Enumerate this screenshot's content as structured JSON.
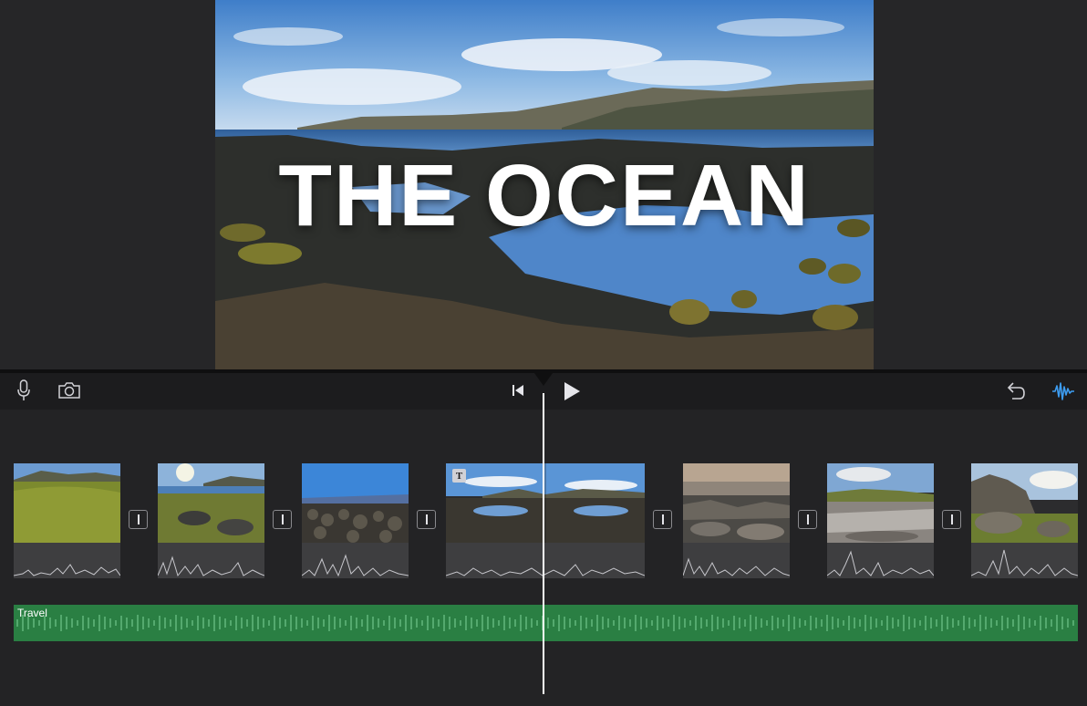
{
  "preview": {
    "title_text": "THE OCEAN"
  },
  "toolbar": {
    "voiceover_icon": "microphone-icon",
    "camera_icon": "camera-icon",
    "skip_back_icon": "skip-to-start-icon",
    "play_icon": "play-icon",
    "undo_icon": "undo-icon",
    "audio_icon": "audio-waveform-icon",
    "audio_icon_color": "#3d9cf0"
  },
  "timeline": {
    "clips": [
      {
        "name": "grassy-coast",
        "has_title": false
      },
      {
        "name": "rocky-shore-sun",
        "has_title": false
      },
      {
        "name": "pebble-beach",
        "has_title": false
      },
      {
        "name": "tide-pool",
        "has_title": true,
        "title_badge": "T"
      },
      {
        "name": "wet-rocks",
        "has_title": false
      },
      {
        "name": "rock-pool-reflection",
        "has_title": false
      },
      {
        "name": "boulders-grass",
        "has_title": false
      }
    ],
    "music_track": {
      "label": "Travel",
      "color": "#2a7f43"
    }
  }
}
